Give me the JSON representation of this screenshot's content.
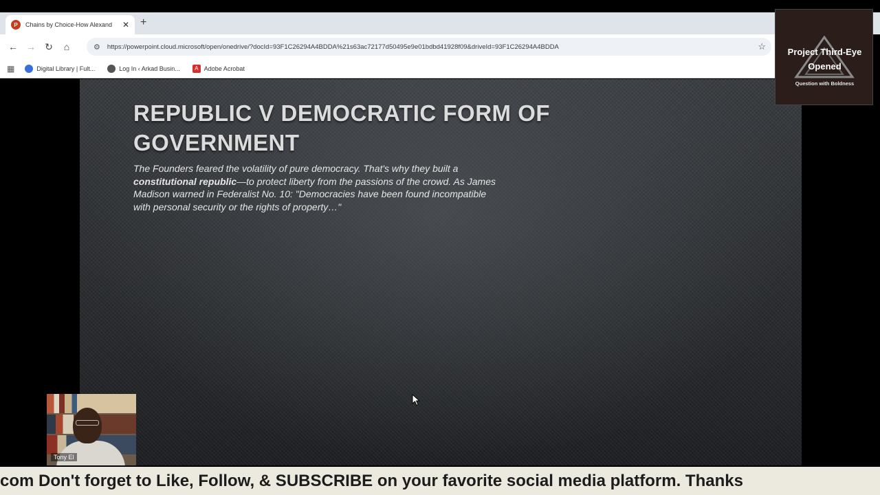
{
  "browser": {
    "tab_title": "Chains by Choice-How Alexand",
    "url": "https://powerpoint.cloud.microsoft/open/onedrive/?docId=93F1C26294A4BDDA%21s63ac72177d50495e9e01bdbd41928f09&driveId=93F1C26294A4BDDA",
    "bookmarks": [
      {
        "label": "Digital Library | Fult...",
        "icon": "library-icon",
        "color": "#3b6fd8"
      },
      {
        "label": "Log In ‹ Arkad Busin...",
        "icon": "globe-icon",
        "color": "#555555"
      },
      {
        "label": "Adobe Acrobat",
        "icon": "acrobat-icon",
        "color": "#d32f2f"
      }
    ]
  },
  "slide": {
    "title": "REPUBLIC V DEMOCRATIC FORM OF GOVERNMENT",
    "body_pre": "The Founders feared the volatility of pure democracy. That's why they built a ",
    "body_bold": "constitutional republic",
    "body_post": "—to protect liberty from the passions of the crowd. As James Madison warned in Federalist No. 10: \"Democracies have been found incompatible with personal security or the rights of property…\""
  },
  "overlay_logo": {
    "line1": "Project Third-Eye",
    "line2": "Opened",
    "tagline": "Question with Boldness"
  },
  "webcam": {
    "name": "Tony El"
  },
  "ticker": {
    "text": "com Don't forget to Like, Follow, & SUBSCRIBE on your favorite social media platform. Thanks"
  }
}
